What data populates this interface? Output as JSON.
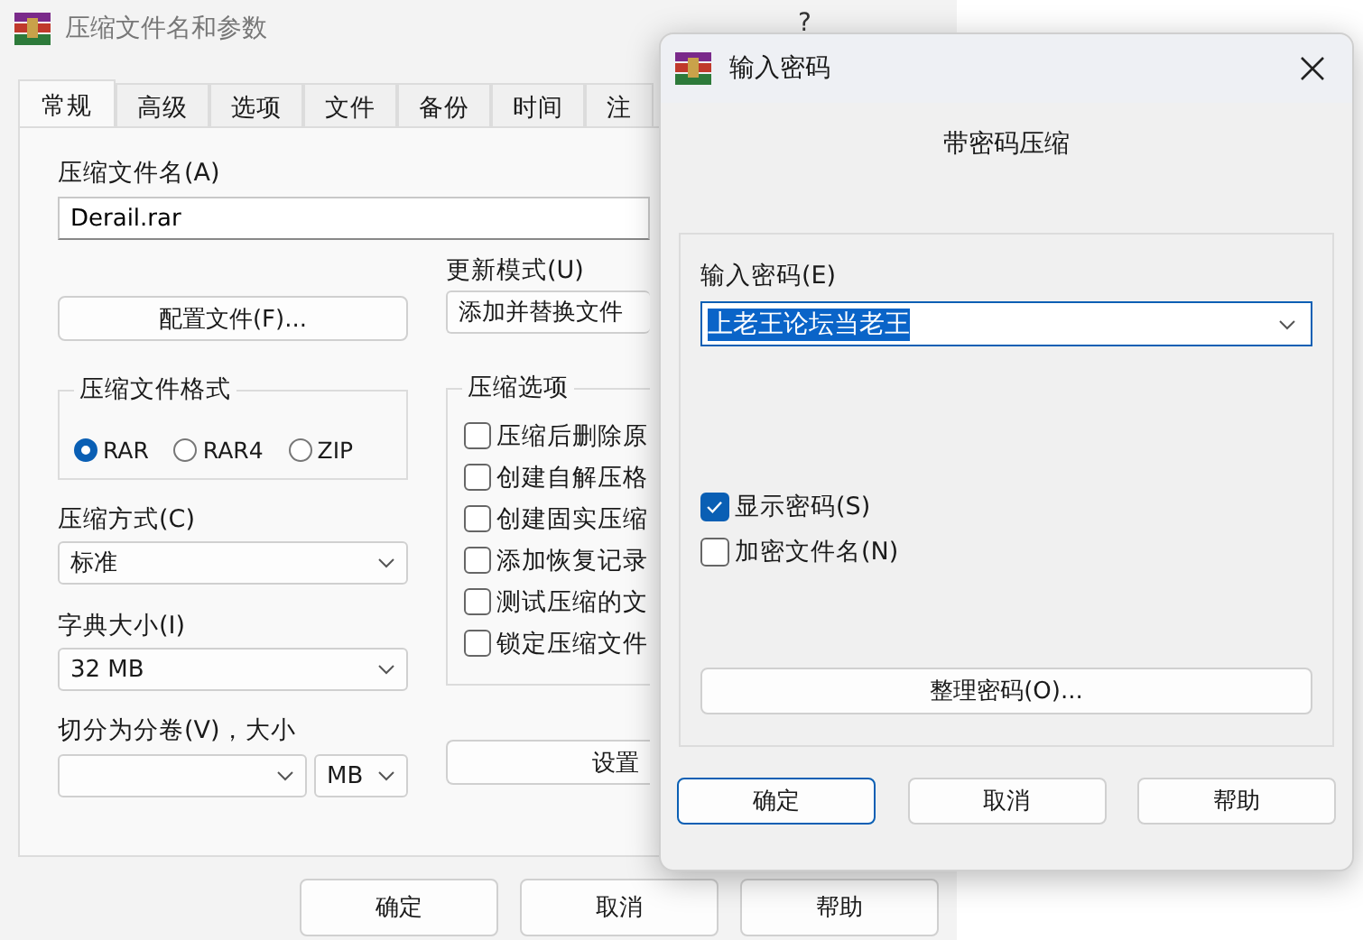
{
  "main_window": {
    "title": "压缩文件名和参数",
    "help_button": "?",
    "tabs": [
      {
        "label": "常规",
        "selected": true
      },
      {
        "label": "高级",
        "selected": false
      },
      {
        "label": "选项",
        "selected": false
      },
      {
        "label": "文件",
        "selected": false
      },
      {
        "label": "备份",
        "selected": false
      },
      {
        "label": "时间",
        "selected": false
      },
      {
        "label": "注",
        "selected": false
      }
    ],
    "archive_name": {
      "label": "压缩文件名(A)",
      "value": "Derail.rar"
    },
    "profiles_button": "配置文件(F)...",
    "update_mode": {
      "label": "更新模式(U)",
      "value": "添加并替换文件"
    },
    "format": {
      "title": "压缩文件格式",
      "options": [
        {
          "label": "RAR",
          "selected": true
        },
        {
          "label": "RAR4",
          "selected": false
        },
        {
          "label": "ZIP",
          "selected": false
        }
      ]
    },
    "method": {
      "label": "压缩方式(C)",
      "value": "标准"
    },
    "dictionary": {
      "label": "字典大小(I)",
      "value": "32 MB"
    },
    "split": {
      "label": "切分为分卷(V)，大小",
      "unit": "MB"
    },
    "options": {
      "title": "压缩选项",
      "items": [
        {
          "label": "压缩后删除原",
          "checked": false
        },
        {
          "label": "创建自解压格",
          "checked": false
        },
        {
          "label": "创建固实压缩",
          "checked": false
        },
        {
          "label": "添加恢复记录",
          "checked": false
        },
        {
          "label": "测试压缩的文",
          "checked": false
        },
        {
          "label": "锁定压缩文件",
          "checked": false
        }
      ]
    },
    "set_password_button": "设置",
    "buttons": [
      "确定",
      "取消",
      "帮助"
    ]
  },
  "password_dialog": {
    "title": "输入密码",
    "subtitle": "带密码压缩",
    "password": {
      "label": "输入密码(E)",
      "value": "上老王论坛当老王",
      "selected": true
    },
    "checkboxes": [
      {
        "label": "显示密码(S)",
        "checked": true
      },
      {
        "label": "加密文件名(N)",
        "checked": false
      }
    ],
    "organize_button": "整理密码(O)...",
    "buttons": [
      {
        "label": "确定",
        "default": true
      },
      {
        "label": "取消",
        "default": false
      },
      {
        "label": "帮助",
        "default": false
      }
    ]
  }
}
